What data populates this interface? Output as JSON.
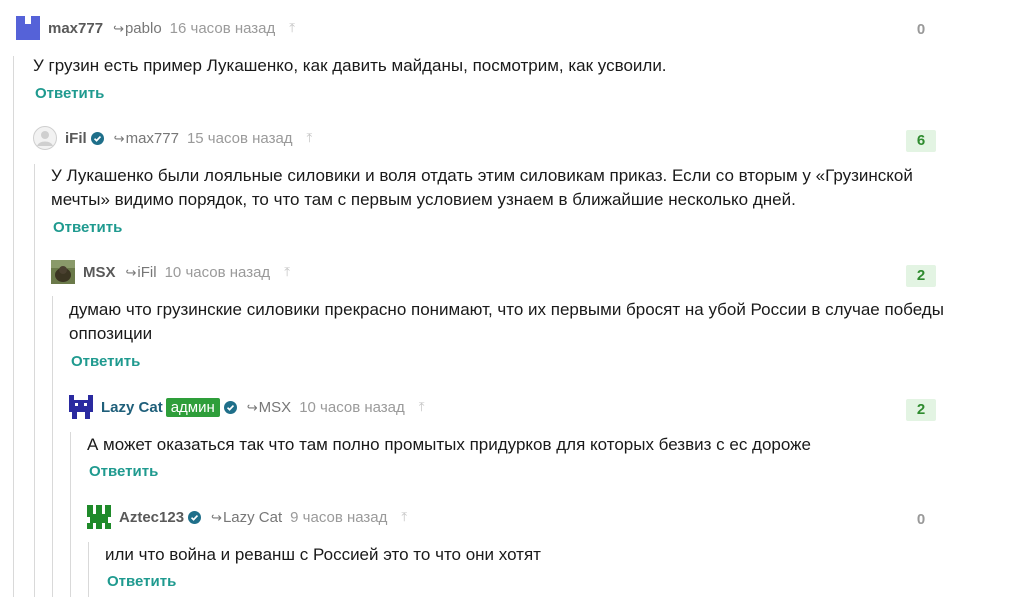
{
  "comments": [
    {
      "author": "max777",
      "reply_to": "pablo",
      "time": "16 часов назад",
      "score": "0",
      "text": "У грузин есть пример Лукашенко, как давить майданы, посмотрим, как усвоили.",
      "reply_label": "Ответить",
      "avatar_color": "#5562d8"
    },
    {
      "author": "iFil",
      "reply_to": "max777",
      "time": "15 часов назад",
      "score": "6",
      "text": "У Лукашенко были лояльные силовики и воля отдать этим силовикам приказ. Если со вторым у «Грузинской мечты» видимо порядок, то что там с первым условием узнаем в ближайшие несколько дней.",
      "reply_label": "Ответить"
    },
    {
      "author": "MSX",
      "reply_to": "iFil",
      "time": "10 часов назад",
      "score": "2",
      "text": "думаю что грузинские силовики прекрасно понимают, что их первыми бросят на убой России в случае победы оппозиции",
      "reply_label": "Ответить"
    },
    {
      "author": "Lazy Cat",
      "badge": "админ",
      "reply_to": "MSX",
      "time": "10 часов назад",
      "score": "2",
      "text": "А может оказаться так что там полно промытых придурков для которых безвиз с ес дороже",
      "reply_label": "Ответить",
      "avatar_color": "#2a2aa0"
    },
    {
      "author": "Aztec123",
      "reply_to": "Lazy Cat",
      "time": "9 часов назад",
      "score": "0",
      "text": "или что война и реванш с Россией это то что они хотят",
      "reply_label": "Ответить",
      "avatar_color": "#1f8a2a"
    }
  ],
  "colors": {
    "reply_link": "#1f9a8f",
    "score_positive": "#2e8b2e",
    "admin_badge": "#2e9e3a",
    "verified": "#1f6f8a"
  }
}
